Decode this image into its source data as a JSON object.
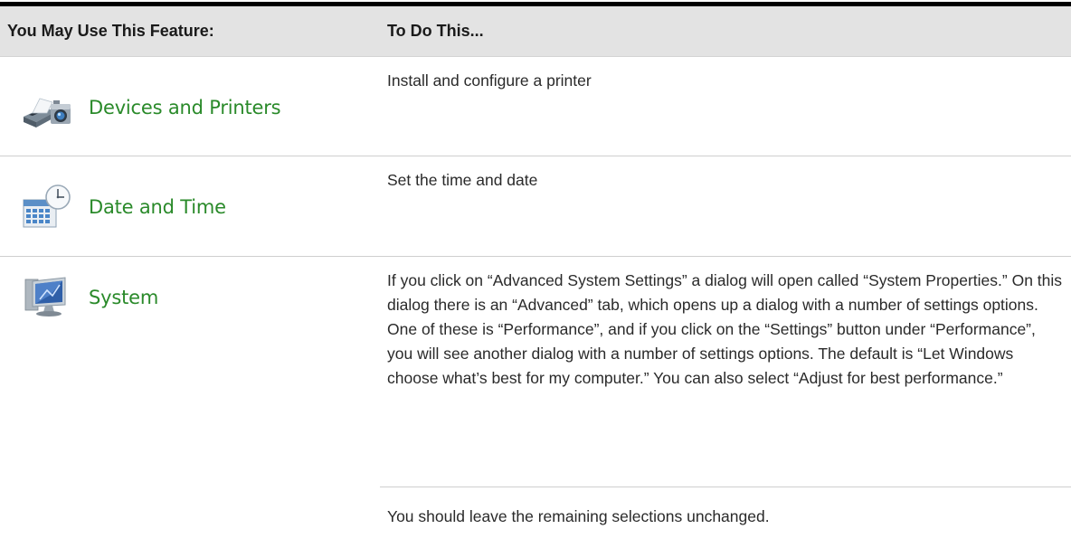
{
  "table": {
    "header": {
      "col1": "You May Use This Feature:",
      "col2": "To Do This..."
    },
    "rows": [
      {
        "feature_label": "Devices and Printers",
        "icon": "printer-camera-icon",
        "description": "Install and configure a printer"
      },
      {
        "feature_label": "Date and Time",
        "icon": "calendar-clock-icon",
        "description": "Set the time and date"
      },
      {
        "feature_label": "System",
        "icon": "computer-monitor-icon",
        "description": "If you click on “Advanced System Settings” a dialog will open called “System Properties.” On this dialog there is an “Advanced” tab, which opens up a dialog with a number of settings options. One of these is “Performance”, and if you click on the “Settings” button under “Performance”, you will see another dialog with a number of settings options.   The default is “Let Windows choose what’s best for my computer.” You can also select “Adjust for best performance.”",
        "note": "You should leave the remaining selections unchanged."
      }
    ]
  },
  "colors": {
    "feature_label": "#2a8a2a",
    "header_bg": "#e3e3e3",
    "rule": "#000000"
  }
}
